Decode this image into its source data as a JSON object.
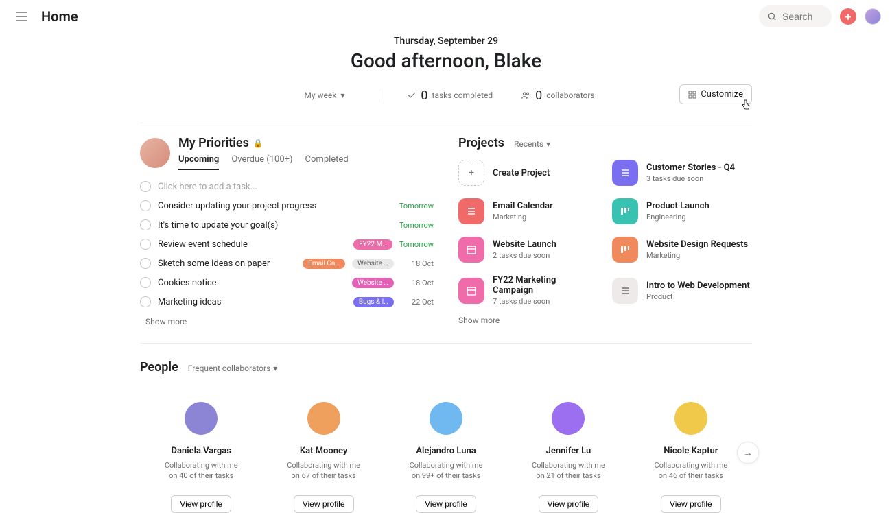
{
  "header": {
    "title": "Home",
    "search_placeholder": "Search"
  },
  "hero": {
    "date": "Thursday, September 29",
    "greeting": "Good afternoon, Blake",
    "filter_label": "My week",
    "tasks_completed_count": "0",
    "tasks_completed_label": "tasks completed",
    "collaborators_count": "0",
    "collaborators_label": "collaborators",
    "customize_label": "Customize"
  },
  "priorities": {
    "title": "My Priorities",
    "tabs": {
      "upcoming": "Upcoming",
      "overdue": "Overdue (100+)",
      "completed": "Completed"
    },
    "add_placeholder": "Click here to add a task...",
    "tasks": [
      {
        "name": "Consider updating your project progress",
        "tags": [],
        "due": "Tomorrow",
        "due_color": "green"
      },
      {
        "name": "It's time to update your goal(s)",
        "tags": [],
        "due": "Tomorrow",
        "due_color": "green"
      },
      {
        "name": "Review event schedule",
        "tags": [
          {
            "text": "FY22 M…",
            "cls": "pink"
          }
        ],
        "due": "Tomorrow",
        "due_color": "green"
      },
      {
        "name": "Sketch some ideas on paper",
        "tags": [
          {
            "text": "Email Ca…",
            "cls": "orange"
          },
          {
            "text": "Website …",
            "cls": "gray"
          }
        ],
        "due": "18 Oct",
        "due_color": ""
      },
      {
        "name": "Cookies notice",
        "tags": [
          {
            "text": "Website …",
            "cls": "magenta"
          }
        ],
        "due": "18 Oct",
        "due_color": ""
      },
      {
        "name": "Marketing ideas",
        "tags": [
          {
            "text": "Bugs & I…",
            "cls": "purple"
          }
        ],
        "due": "22 Oct",
        "due_color": ""
      }
    ],
    "show_more": "Show more"
  },
  "projects": {
    "title": "Projects",
    "filter": "Recents",
    "create_label": "Create Project",
    "items": [
      {
        "name": "Customer Stories - Q4",
        "sub": "3 tasks due soon",
        "cls": "purple",
        "icon": "list"
      },
      {
        "name": "Email Calendar",
        "sub": "Marketing",
        "cls": "red",
        "icon": "list"
      },
      {
        "name": "Product Launch",
        "sub": "Engineering",
        "cls": "teal",
        "icon": "board"
      },
      {
        "name": "Website Launch",
        "sub": "2 tasks due soon",
        "cls": "pink",
        "icon": "cal"
      },
      {
        "name": "Website Design Requests",
        "sub": "Marketing",
        "cls": "orange",
        "icon": "board"
      },
      {
        "name": "FY22 Marketing Campaign",
        "sub": "7 tasks due soon",
        "cls": "pink",
        "icon": "cal"
      },
      {
        "name": "Intro to Web Development",
        "sub": "Product",
        "cls": "graylite",
        "icon": "list"
      }
    ],
    "show_more": "Show more"
  },
  "people": {
    "title": "People",
    "filter": "Frequent collaborators",
    "view_label": "View profile",
    "items": [
      {
        "name": "Daniela Vargas",
        "line1": "Collaborating with me",
        "line2": "on 40 of their tasks",
        "bg": "#8c85d6"
      },
      {
        "name": "Kat Mooney",
        "line1": "Collaborating with me",
        "line2": "on 67 of their tasks",
        "bg": "#f0a05d"
      },
      {
        "name": "Alejandro Luna",
        "line1": "Collaborating with me",
        "line2": "on 99+ of their tasks",
        "bg": "#6fb8f0"
      },
      {
        "name": "Jennifer Lu",
        "line1": "Collaborating with me",
        "line2": "on 21 of their tasks",
        "bg": "#9b6ff0"
      },
      {
        "name": "Nicole Kaptur",
        "line1": "Collaborating with me",
        "line2": "on 46 of their tasks",
        "bg": "#f0c84a"
      }
    ]
  }
}
